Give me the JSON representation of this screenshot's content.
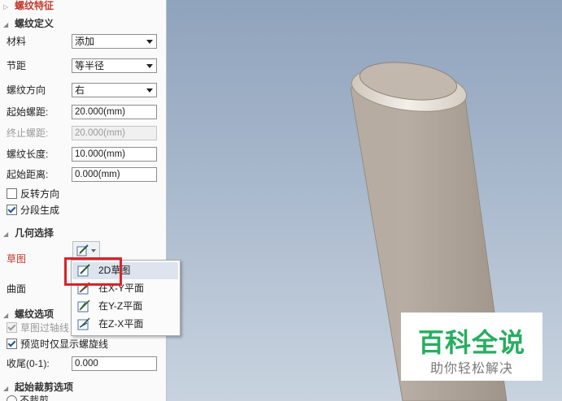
{
  "panel": {
    "section_thread_feature": "螺纹特征",
    "section_thread_def": "螺纹定义",
    "material_label": "材料",
    "material_value": "添加",
    "pitch_label": "节距",
    "pitch_value": "等半径",
    "direction_label": "螺纹方向",
    "direction_value": "右",
    "start_pitch_label": "起始螺距:",
    "start_pitch_value": "20.000(mm)",
    "end_pitch_label": "终止螺距:",
    "end_pitch_value": "20.000(mm)",
    "thread_length_label": "螺纹长度:",
    "thread_length_value": "10.000(mm)",
    "start_distance_label": "起始距离:",
    "start_distance_value": "0.000(mm)",
    "reverse_label": "反转方向",
    "reverse_checked": false,
    "segment_label": "分段生成",
    "segment_checked": true,
    "section_geometry": "几何选择",
    "sketch_label": "草图",
    "surface_label": "曲面",
    "section_thread_options": "螺纹选项",
    "sketch_axis_label": "草图过轴线",
    "sketch_axis_checked": true,
    "preview_label": "预览时仅显示螺旋线",
    "preview_checked": true,
    "tail_label": "收尾(0-1):",
    "tail_value": "0.000",
    "section_start_trim": "起始裁剪选项",
    "no_trim_label": "不裁剪"
  },
  "menu": {
    "items": [
      "2D草图",
      "在X-Y平面",
      "在Y-Z平面",
      "在Z-X平面"
    ],
    "highlighted_index": 0
  },
  "watermark": {
    "title": "百科全说",
    "subtitle": "助你轻松解决",
    "color": "#27ae60"
  },
  "colors": {
    "highlight_box": "#d9232a",
    "section_red": "#c0392b"
  }
}
